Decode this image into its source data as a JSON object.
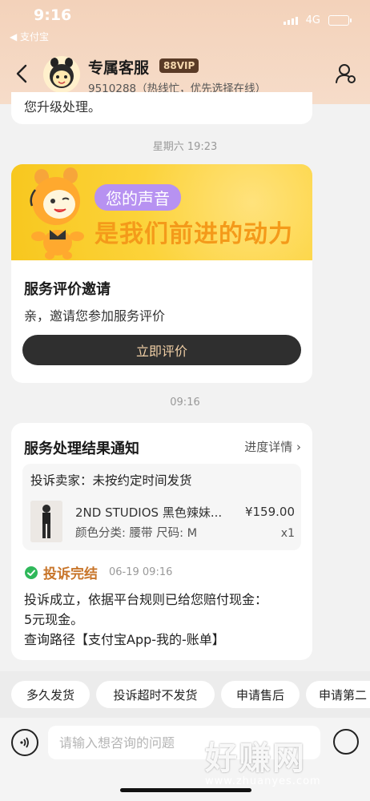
{
  "status_bar": {
    "time": "9:16",
    "back_app": "◀ 支付宝",
    "network": "4G"
  },
  "header": {
    "title": "专属客服",
    "badge": "88VIP",
    "subtitle": "9510288（热线忙，优先选择在线）"
  },
  "chat": {
    "cut_message": "您升级处理。",
    "time1": "星期六 19:23",
    "invite": {
      "banner_pill": "您的声音",
      "banner_main": "是我们前进的动力",
      "title": "服务评价邀请",
      "text": "亲，邀请您参加服务评价",
      "button": "立即评价"
    },
    "time2": "09:16",
    "result": {
      "title": "服务处理结果通知",
      "link": "进度详情 ›",
      "complaint": "投诉卖家：未按约定时间发货",
      "product_name": "2ND STUDIOS 黑色辣妹...",
      "product_spec": "颜色分类: 腰带 尺码: M",
      "price": "¥159.00",
      "qty": "x1",
      "status": "投诉完结",
      "status_date": "06-19 09:16",
      "body_line1": "投诉成立，依据平台规则已给您赔付现金：",
      "body_line2": "5元现金。",
      "body_line3": "查询路径【支付宝App-我的-账单】"
    }
  },
  "quick_replies": [
    "多久发货",
    "投诉超时不发货",
    "申请售后",
    "申请第二"
  ],
  "input": {
    "placeholder": "请输入想咨询的问题"
  },
  "watermark": {
    "big": "好赚网",
    "small": "www.zhuanyes.com"
  },
  "colors": {
    "accent": "#c8752a",
    "header_bg": "#f3d2ba",
    "success": "#2fb85a"
  }
}
